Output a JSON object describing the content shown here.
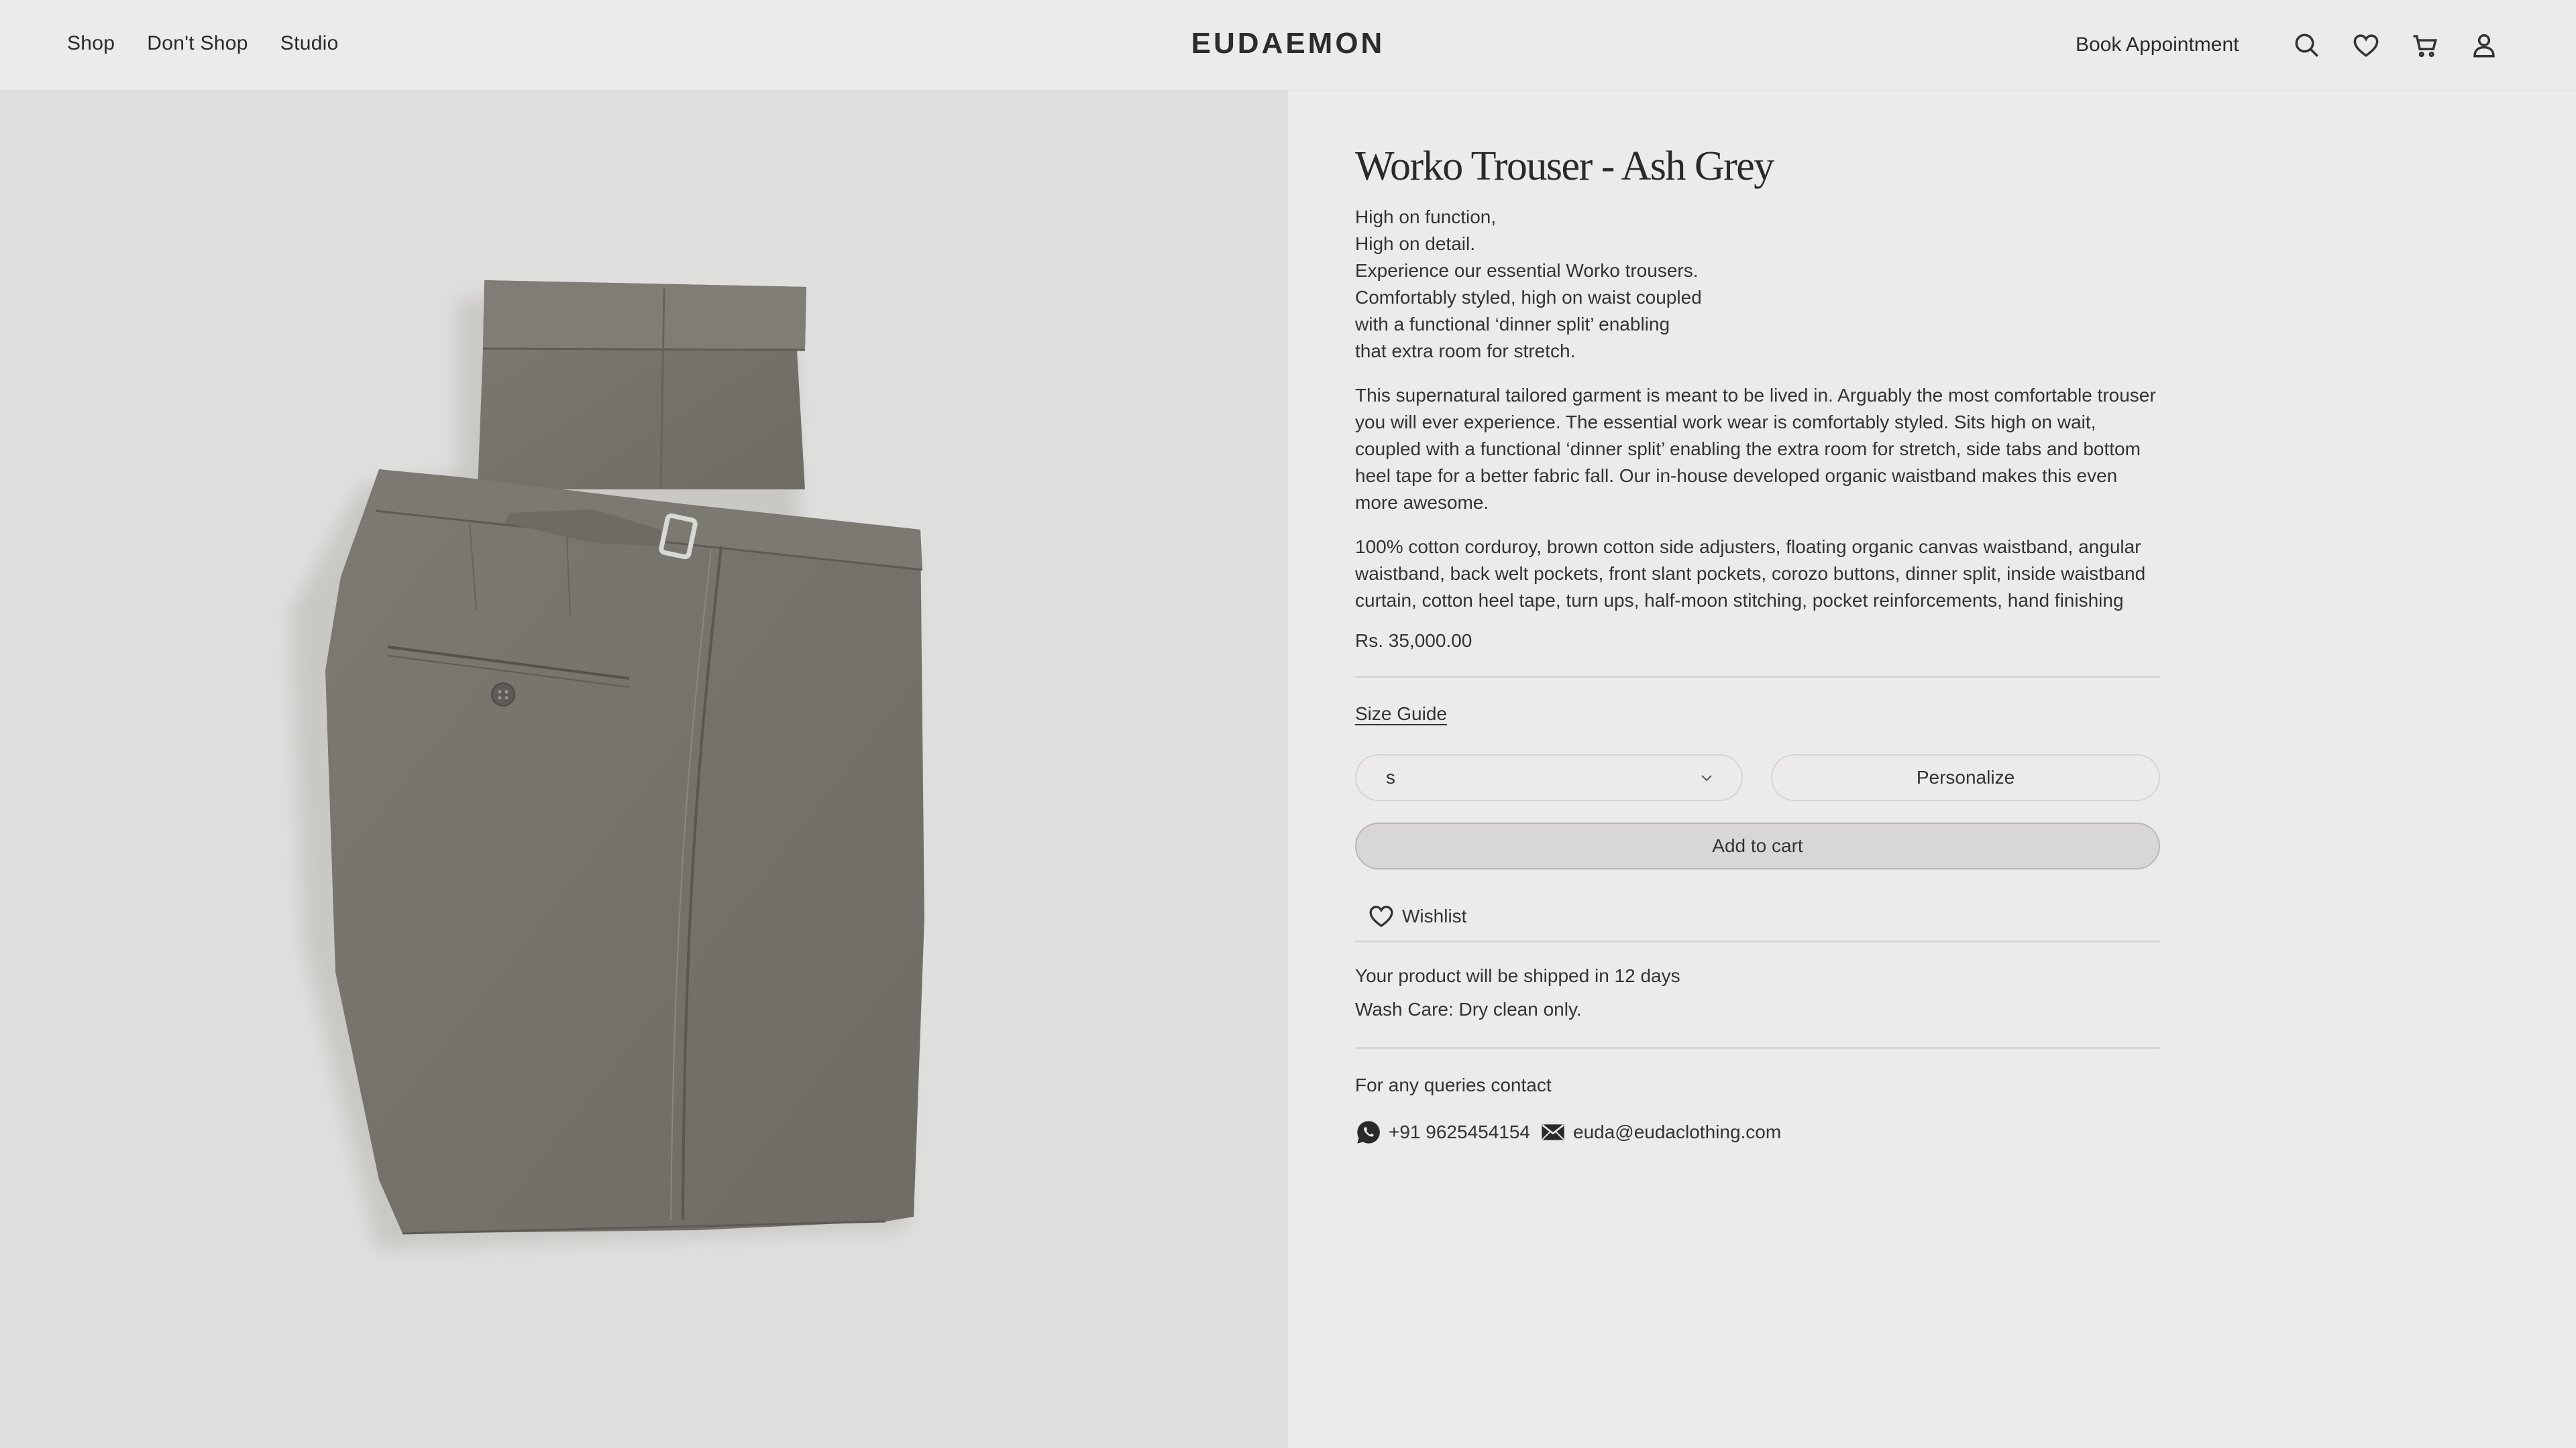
{
  "nav": {
    "items": [
      "Shop",
      "Don't Shop",
      "Studio"
    ],
    "brand": "EUDAEMON",
    "book_appointment": "Book Appointment",
    "icons": [
      "search-icon",
      "heart-icon",
      "cart-icon",
      "user-icon"
    ]
  },
  "product": {
    "title": "Worko Trouser - Ash Grey",
    "tagline": [
      "High on function,",
      "High on detail.",
      "Experience our essential Worko trousers.",
      "Comfortably styled, high on waist coupled",
      "with a functional ‘dinner split’ enabling",
      "that extra room for stretch."
    ],
    "description": "This supernatural tailored garment is meant to be lived in. Arguably the most comfortable trouser you will ever experience. The essential work wear is comfortably styled. Sits high on wait, coupled with a functional ‘dinner split’ enabling the extra room for stretch, side tabs and bottom heel tape for a better fabric fall. Our in-house developed organic waistband makes this even more awesome.",
    "details": "100% cotton corduroy, brown cotton side adjusters, floating organic canvas waistband, angular waistband, back welt pockets, front slant pockets, corozo buttons, dinner split, inside waistband curtain, cotton heel tape, turn ups, half-moon stitching, pocket reinforcements, hand finishing",
    "price": "Rs. 35,000.00",
    "size_guide": "Size Guide",
    "size_selected": "s",
    "personalize": "Personalize",
    "add_to_cart": "Add to cart",
    "wishlist": "Wishlist",
    "shipping": "Your product will be shipped in 12 days",
    "wash_care": "Wash Care: Dry clean only.",
    "queries": "For any queries contact",
    "phone": "+91 9625454154",
    "email": "euda@eudaclothing.com"
  },
  "colors": {
    "background": "#ebebe9",
    "image_panel": "#dfdfdd",
    "fabric": "#7a766f",
    "text": "#2a2a2a"
  }
}
